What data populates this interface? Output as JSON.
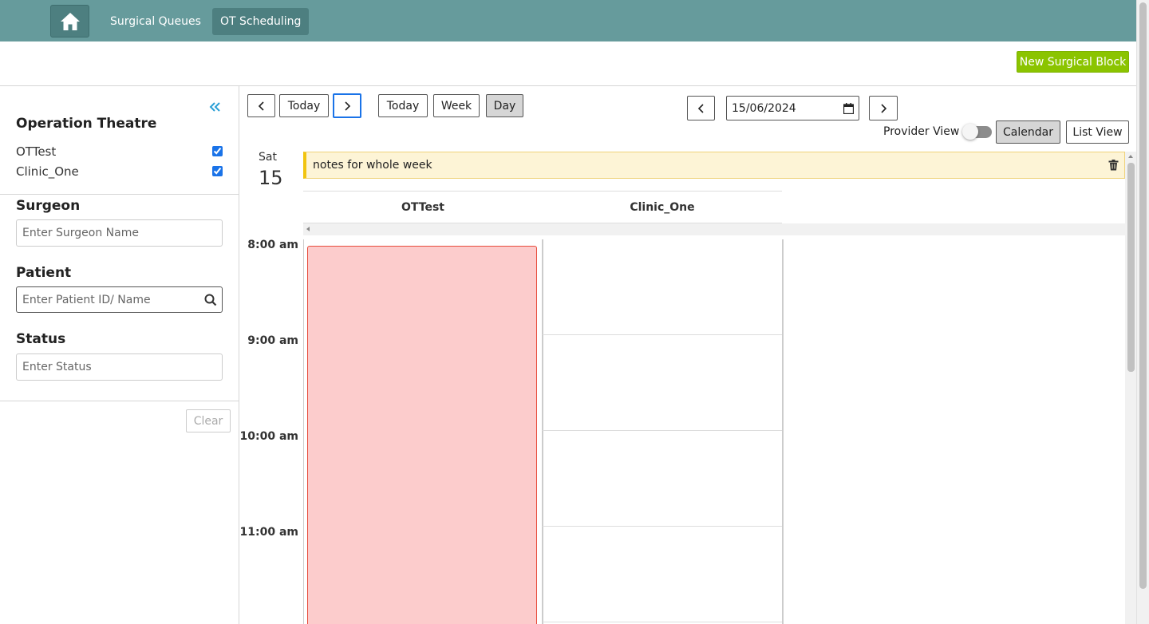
{
  "nav": {
    "home_icon": "home-icon",
    "links": [
      "Surgical Queues",
      "OT Scheduling"
    ],
    "active_link": "OT Scheduling"
  },
  "header": {
    "new_block_label": "New Surgical Block"
  },
  "sidebar": {
    "collapse_icon": "double-chevron-left-icon",
    "ot_heading": "Operation Theatre",
    "ot_items": [
      {
        "label": "OTTest",
        "checked": true
      },
      {
        "label": "Clinic_One",
        "checked": true
      }
    ],
    "surgeon_heading": "Surgeon",
    "surgeon_placeholder": "Enter Surgeon Name",
    "patient_heading": "Patient",
    "patient_placeholder": "Enter Patient ID/ Name",
    "status_heading": "Status",
    "status_placeholder": "Enter Status",
    "clear_label": "Clear"
  },
  "toolbar": {
    "prev_icon": "chevron-left-icon",
    "today_label": "Today",
    "next_icon": "chevron-right-icon",
    "view_today_label": "Today",
    "week_label": "Week",
    "day_label": "Day",
    "active_view": "Day",
    "date_value": "15/06/2024",
    "provider_view_label": "Provider View",
    "provider_view_on": false,
    "calendar_label": "Calendar",
    "list_view_label": "List View",
    "active_mode": "Calendar"
  },
  "calendar": {
    "day_name": "Sat",
    "day_number": "15",
    "note_text": "notes for whole week",
    "resources": [
      "OTTest",
      "Clinic_One"
    ],
    "time_labels": [
      "8:00 am",
      "9:00 am",
      "10:00 am",
      "11:00 am"
    ],
    "event": {
      "resource": "OTTest",
      "start": "8:00 am",
      "color": "#fccccc",
      "border_color": "#e74c3c"
    }
  },
  "colors": {
    "topbar": "#669b9c",
    "nav_active": "#4d7f80",
    "new_block": "#8bc400",
    "note_bg": "#fdf4d6",
    "note_accent": "#f1c40f",
    "focus": "#1a73e8"
  }
}
